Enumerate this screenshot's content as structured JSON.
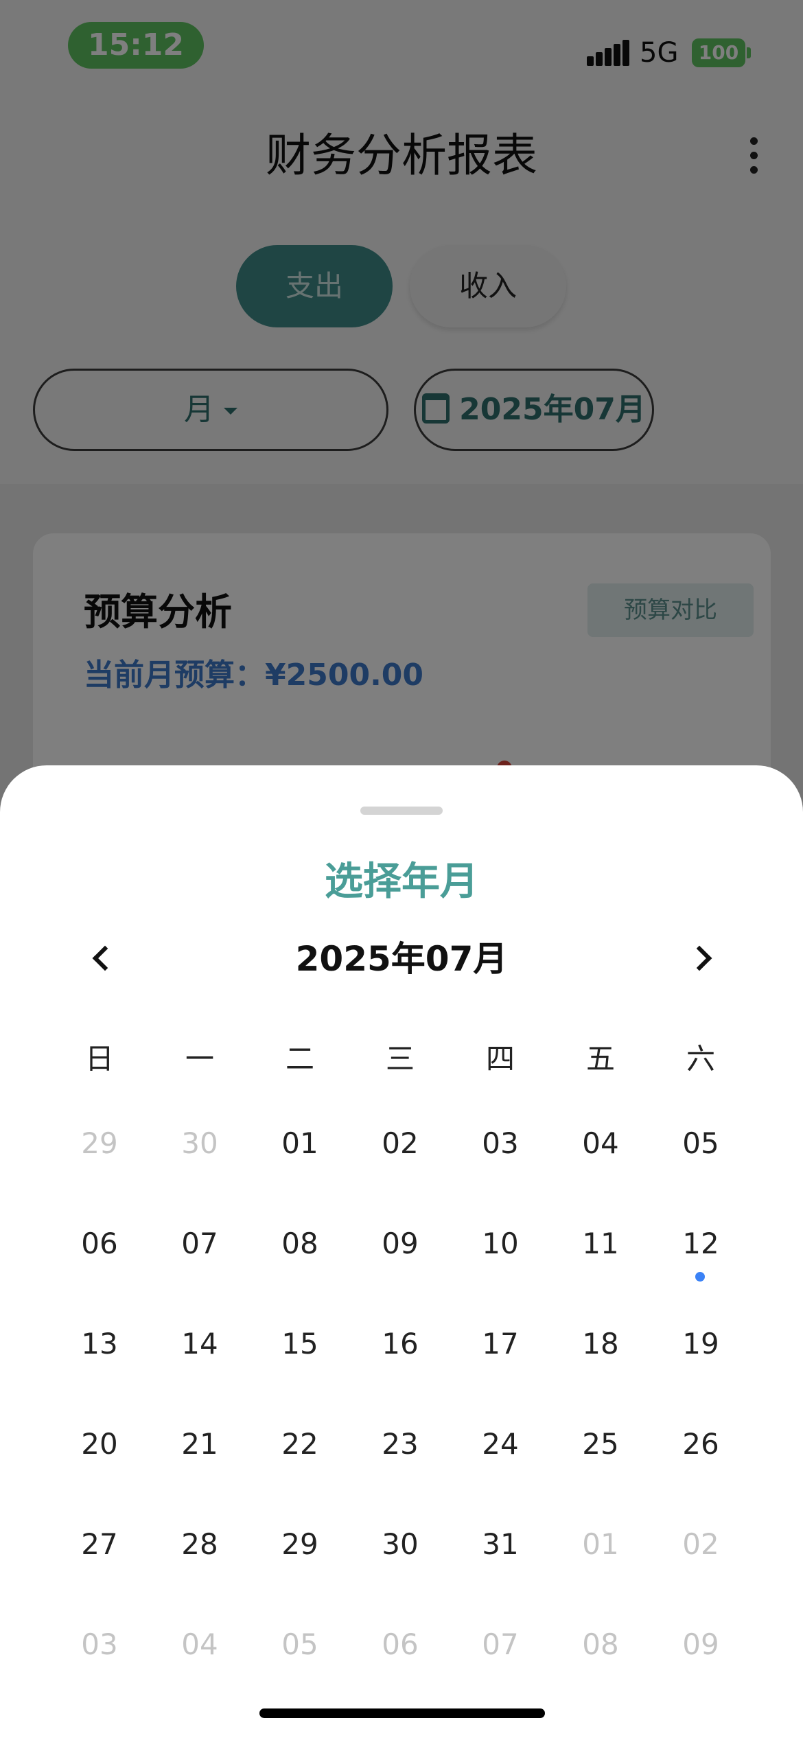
{
  "status_bar": {
    "time": "15:12",
    "network": "5G",
    "battery": "100"
  },
  "header": {
    "title": "财务分析报表",
    "more_icon": "more-vertical-icon"
  },
  "segment": {
    "expense_label": "支出",
    "income_label": "收入",
    "selected": "支出"
  },
  "filters": {
    "period_label": "月",
    "date_label": "2025年07月",
    "date_icon": "calendar-icon"
  },
  "budget_card": {
    "title": "预算分析",
    "budget_text": "当前月预算：¥2500.00",
    "compare_button": "预算对比"
  },
  "sheet": {
    "title": "选择年月",
    "month_label": "2025年07月",
    "prev_icon": "chevron-left-icon",
    "next_icon": "chevron-right-icon",
    "weekdays": [
      "日",
      "一",
      "二",
      "三",
      "四",
      "五",
      "六"
    ],
    "days": [
      {
        "label": "29",
        "other": true
      },
      {
        "label": "30",
        "other": true
      },
      {
        "label": "01"
      },
      {
        "label": "02"
      },
      {
        "label": "03"
      },
      {
        "label": "04"
      },
      {
        "label": "05"
      },
      {
        "label": "06"
      },
      {
        "label": "07"
      },
      {
        "label": "08"
      },
      {
        "label": "09"
      },
      {
        "label": "10"
      },
      {
        "label": "11"
      },
      {
        "label": "12",
        "today": true
      },
      {
        "label": "13"
      },
      {
        "label": "14"
      },
      {
        "label": "15"
      },
      {
        "label": "16"
      },
      {
        "label": "17"
      },
      {
        "label": "18"
      },
      {
        "label": "19"
      },
      {
        "label": "20"
      },
      {
        "label": "21"
      },
      {
        "label": "22"
      },
      {
        "label": "23"
      },
      {
        "label": "24"
      },
      {
        "label": "25"
      },
      {
        "label": "26"
      },
      {
        "label": "27"
      },
      {
        "label": "28"
      },
      {
        "label": "29"
      },
      {
        "label": "30"
      },
      {
        "label": "31"
      },
      {
        "label": "01",
        "other": true
      },
      {
        "label": "02",
        "other": true
      },
      {
        "label": "03",
        "other": true
      },
      {
        "label": "04",
        "other": true
      },
      {
        "label": "05",
        "other": true
      },
      {
        "label": "06",
        "other": true
      },
      {
        "label": "07",
        "other": true
      },
      {
        "label": "08",
        "other": true
      },
      {
        "label": "09",
        "other": true
      }
    ]
  },
  "colors": {
    "accent": "#3e8a88",
    "sheet_title": "#4a9d97",
    "budget_blue": "#3d78c9",
    "today_dot": "#3b82f6",
    "status_green": "#5ec261"
  }
}
